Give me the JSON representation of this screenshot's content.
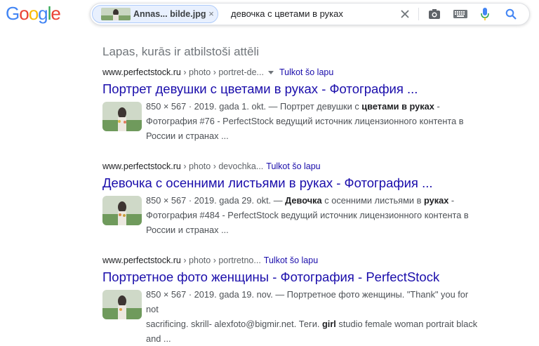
{
  "logo": {
    "text": "Google",
    "letters": [
      "G",
      "o",
      "o",
      "g",
      "l",
      "e"
    ]
  },
  "search": {
    "chip_label": "Annas... bilde.jpg",
    "chip_close": "×",
    "query": "девочка с цветами в руках"
  },
  "section_title": "Lapas, kurās ir atbilstoši attēli",
  "results": [
    {
      "site": "www.perfectstock.ru",
      "path": " › photo › portret-de...",
      "translate": "Tulkot šo lapu",
      "title": "Портрет девушки с цветами в руках - Фотография ...",
      "meta": "850 × 567 · 2019. gada 1. okt. — ",
      "line1_a": "Портрет девушки с ",
      "line1_b": "цветами в руках",
      "line1_c": " -",
      "line2": "Фотография #76 - PerfectStock ведущий источник лицензионного контента в",
      "line3": "России и странах ..."
    },
    {
      "site": "www.perfectstock.ru",
      "path": " › photo › devochka...",
      "translate": "Tulkot šo lapu",
      "title": "Девочка с осенними листьями в руках - Фотография ...",
      "meta": "850 × 567 · 2019. gada 29. okt. — ",
      "line1_a": "Девочка",
      "line1_b": " с осенними листьями в ",
      "line1_c": "руках",
      "line1_d": " -",
      "line2": "Фотография #484 - PerfectStock ведущий источник лицензионного контента в",
      "line3": "России и странах ..."
    },
    {
      "site": "www.perfectstock.ru",
      "path": " › photo › portretno...",
      "translate": "Tulkot šo lapu",
      "title": "Портретное фото женщины - Фотография - PerfectStock",
      "meta": "850 × 567 · 2019. gada 19. nov. — ",
      "line1_a": "Портретное фото женщины. \"Thank\" you for not",
      "line2_a": "sacrificing. skrill- alexfoto@bigmir.net. Теги. ",
      "line2_b": "girl",
      "line2_c": " studio female woman portrait black",
      "line3": "and ..."
    }
  ],
  "colors": {
    "link": "#1a0dab",
    "translate": "#1a0dab",
    "muted": "#70757a"
  },
  "icons": [
    "close-icon",
    "camera-icon",
    "keyboard-icon",
    "microphone-icon",
    "search-icon"
  ]
}
